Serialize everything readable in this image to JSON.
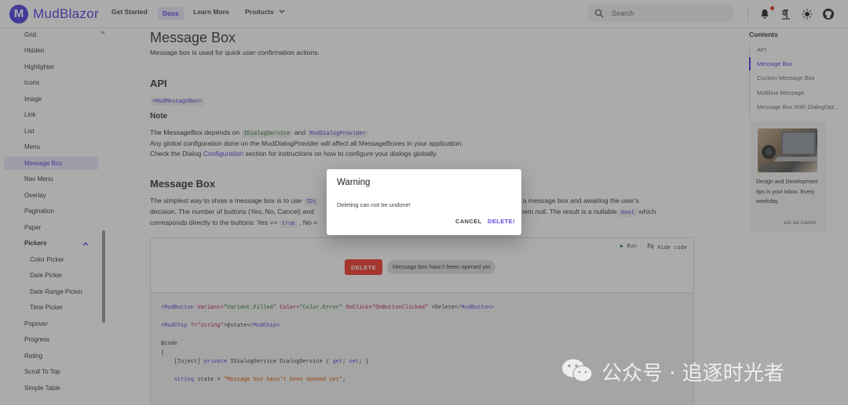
{
  "header": {
    "brand": "MudBlazor",
    "logo_letter": "M",
    "nav": [
      "Get Started",
      "Docs",
      "Learn More",
      "Products"
    ],
    "search_placeholder": "Search"
  },
  "sidebar": {
    "items": [
      "Grid",
      "Hidden",
      "Highlighter",
      "Icons",
      "Image",
      "Link",
      "List",
      "Menu",
      "Message Box",
      "Nav Menu",
      "Overlay",
      "Pagination",
      "Paper",
      "Pickers",
      "Color Picker",
      "Date Picker",
      "Date Range Picker",
      "Time Picker",
      "Popover",
      "Progress",
      "Rating",
      "Scroll To Top",
      "Simple Table"
    ]
  },
  "main": {
    "title": "Message Box",
    "subtitle": "Message box is used for quick user confirmation actions.",
    "api_heading": "API",
    "api_component": "<MudMessageBox>",
    "note_heading": "Note",
    "note_line1_pre": "The MessageBox depends on",
    "note_code1": "IDialogService",
    "note_and": "and",
    "note_code2": "MudDialogProvider",
    "note_line2": "Any global configuration done on the MudDialogProvider will affect all MessageBoxes in your application.",
    "note_line3_pre": "Check the Dialog",
    "note_link": "Configuration",
    "note_line3_post": "section for instructions on how to configure your dialogs globally.",
    "section_heading": "Message Box",
    "desc1_a": "The simplest way to show a message box is to use",
    "desc1_code": "IDi",
    "desc1_b": "howing a message box and awaiting the user's",
    "desc2_a": "decision. The number of buttons (Yes, No, Cancel) and",
    "desc2_b": "g them null. The result is a nullable",
    "desc2_code": "bool",
    "desc2_c": "which",
    "desc3_a": "corresponds directly to the buttons: Yes =>",
    "desc3_code": "true",
    "desc3_b": ", No =",
    "run_label": "Run",
    "hide_code_label": "Hide code",
    "delete_button": "DELETE",
    "chip_text": "Message box hasn't been opened yet",
    "code_lines": {
      "l1_open": "<MudButton",
      "l1_a1": "Variant=",
      "l1_v1": "\"Variant.Filled\"",
      "l1_a2": "Color=",
      "l1_v2": "\"Color.Error\"",
      "l1_a3": "OnClick=",
      "l1_v3": "\"OnButtonClicked\"",
      "l1_text": ">Delete</",
      "l1_close": "MudButton>",
      "l2_open": "<MudChip",
      "l2_a1": "T=",
      "l2_v1": "\"string\"",
      "l2_text": ">@state</",
      "l2_close": "MudChip>",
      "l3": "@code",
      "l4": "{",
      "l5_a": "[Inject]",
      "l5_kw": "private",
      "l5_b": "IDialogService DialogService { ",
      "l5_get": "get",
      "l5_c": "; ",
      "l5_set": "set",
      "l5_d": "; }",
      "l6_kw": "string",
      "l6_a": "state =",
      "l6_str": "\"Message box hasn't been opened yet\"",
      "l6_end": ";"
    }
  },
  "contents": {
    "title": "Contents",
    "items": [
      "API",
      "Message Box",
      "Custom Message Box",
      "Multiline Message",
      "Message Box With DialogOpt..."
    ],
    "ad_text": "Design and Development tips in your inbox. Every weekday.",
    "ad_via": "ads via Carbon"
  },
  "dialog": {
    "title": "Warning",
    "message": "Deleting can not be undone!",
    "cancel": "CANCEL",
    "confirm": "DELETE!"
  },
  "watermark": {
    "text": "公众号 · 追逐时光者"
  },
  "colors": {
    "accent": "#594ae2",
    "error": "#f44336"
  }
}
